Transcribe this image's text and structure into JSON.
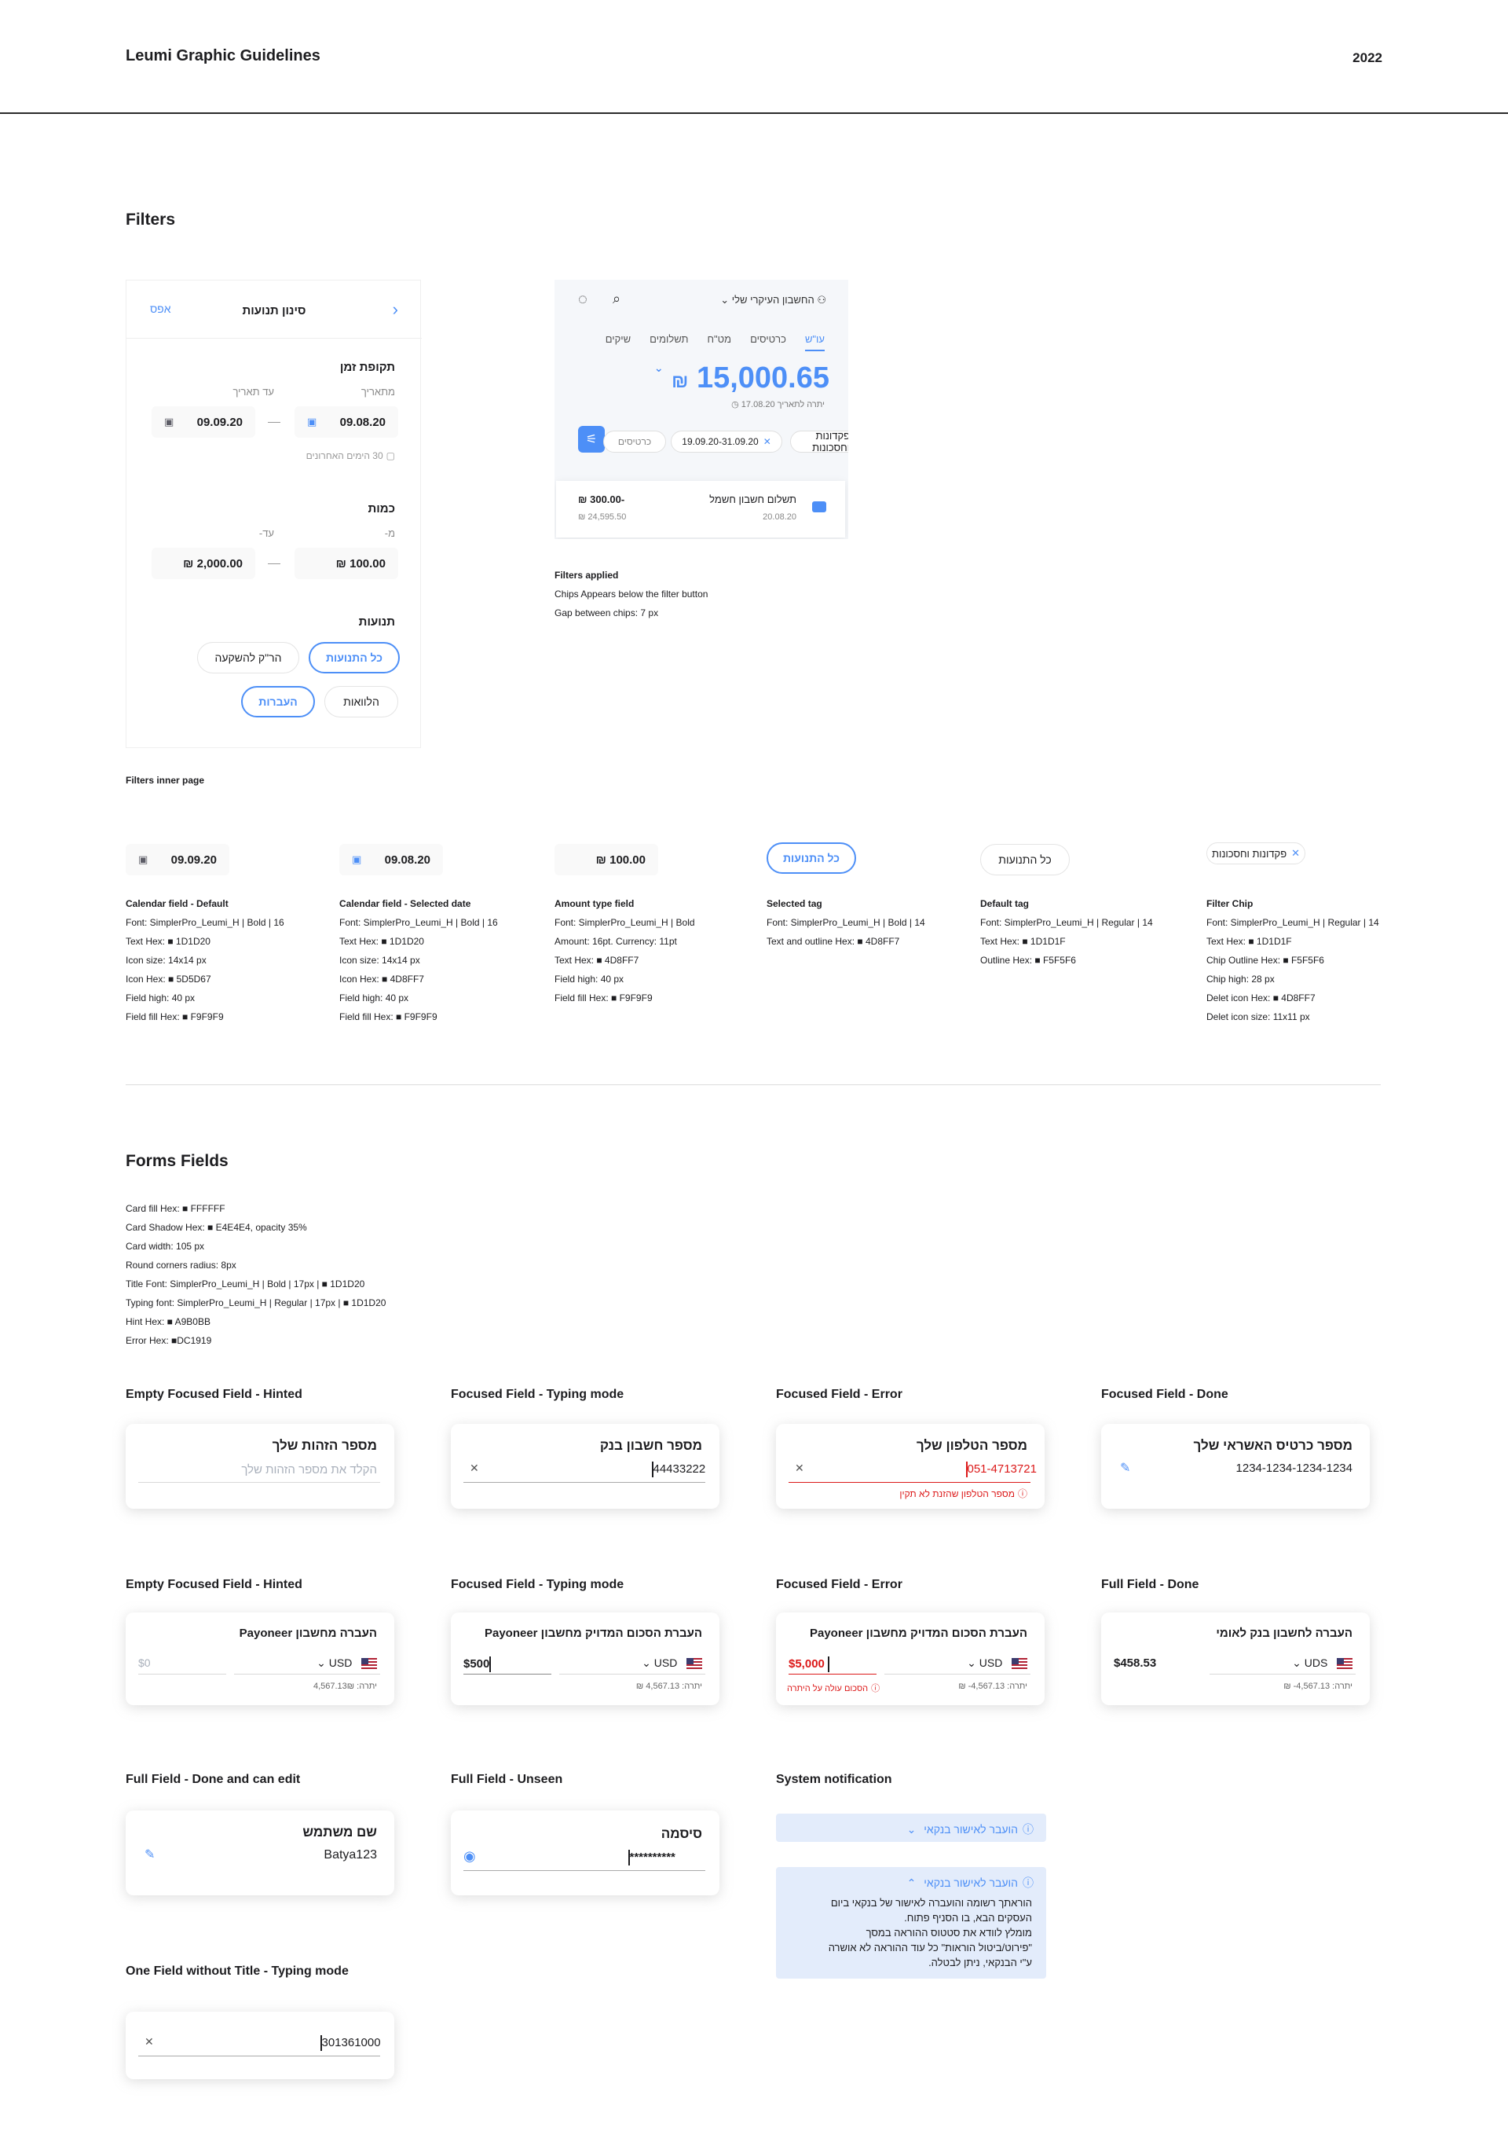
{
  "header": {
    "title": "Leumi Graphic Guidelines",
    "year": "2022"
  },
  "filters": {
    "section_title": "Filters",
    "panel": {
      "reset": "אפס",
      "title": "סינון תנועות",
      "period_heading": "תקופת זמן",
      "from_label": "מתאריך",
      "to_label": "עד תאריך",
      "from_date": "09.08.20",
      "to_date": "09.09.20",
      "last_days": "30 הימים האחרונים",
      "amount_heading": "כמות",
      "amount_from_label": "מ-",
      "amount_to_label": "עד-",
      "amount_from": "100.00 ₪",
      "amount_to": "2,000.00 ₪",
      "tx_heading": "תנועות",
      "tag_all": "כל התנועות",
      "tag_invest": "הר\"ק להשקעה",
      "tag_transfers": "העברות",
      "tag_loans": "הלוואות"
    },
    "caption": "Filters inner page",
    "app": {
      "account": "החשבון העיקרי שלי",
      "tabs": [
        "עו\"ש",
        "כרטיסים",
        "מט\"ח",
        "תשלומים",
        "שיקים"
      ],
      "balance": "15,000.65",
      "currency": "₪",
      "balance_date": "יתרה לתאריך 17.08.20",
      "chips": [
        "פקדונות וחסכונות",
        "19.09.20-31.09.20",
        "כרטיסים"
      ],
      "tx_name": "תשלום חשבון חשמל",
      "tx_date": "20.08.20",
      "tx_amount": "-300.00 ₪",
      "tx_balance": "24,595.50 ₪"
    },
    "applied_notes": [
      "Filters applied",
      "Chips Appears below the filter button",
      "Gap between chips: 7 px"
    ]
  },
  "components": [
    {
      "sample": "09.09.20",
      "title": "Calendar field - Default",
      "lines": [
        "Font: SimplerPro_Leumi_H | Bold | 16",
        "Text Hex: ■ 1D1D20",
        "Icon size: 14x14 px",
        "Icon Hex: ■ 5D5D67",
        "Field high: 40 px",
        "Field fill Hex: ■ F9F9F9"
      ]
    },
    {
      "sample": "09.08.20",
      "title": "Calendar field - Selected date",
      "lines": [
        "Font: SimplerPro_Leumi_H | Bold | 16",
        "Text Hex: ■ 1D1D20",
        "Icon size: 14x14 px",
        "Icon Hex: ■ 4D8FF7",
        "Field high: 40 px",
        "Field fill Hex: ■ F9F9F9"
      ]
    },
    {
      "sample": "100.00 ₪",
      "title": "Amount type field",
      "lines": [
        "Font: SimplerPro_Leumi_H | Bold",
        "Amount: 16pt. Currency: 11pt",
        "Text Hex: ■ 4D8FF7",
        "Field high: 40 px",
        "Field fill Hex: ■ F9F9F9"
      ]
    },
    {
      "sample": "כל התנועות",
      "title": "Selected tag",
      "lines": [
        "Font: SimplerPro_Leumi_H | Bold | 14",
        "Text and outline Hex: ■ 4D8FF7"
      ]
    },
    {
      "sample": "כל התנועות",
      "title": "Default tag",
      "lines": [
        "Font: SimplerPro_Leumi_H | Regular | 14",
        "Text Hex: ■ 1D1D1F",
        "Outline Hex: ■ F5F5F6"
      ]
    },
    {
      "sample": "פקדונות וחסכונות",
      "title": "Filter Chip",
      "lines": [
        "Font: SimplerPro_Leumi_H | Regular | 14",
        "Text Hex: ■ 1D1D1F",
        "Chip Outline Hex: ■ F5F5F6",
        "Chip high: 28 px",
        "Delet icon Hex: ■ 4D8FF7",
        "Delet icon size: 11x11 px"
      ]
    }
  ],
  "forms": {
    "section_title": "Forms Fields",
    "specs": [
      "Card fill Hex: ■ FFFFFF",
      "Card Shadow Hex: ■ E4E4E4, opacity 35%",
      "Card width: 105 px",
      "Round corners radius: 8px",
      "Title Font: SimplerPro_Leumi_H | Bold | 17px | ■ 1D1D20",
      "Typing font: SimplerPro_Leumi_H | Regular | 17px | ■ 1D1D20",
      "Hint Hex: ■ A9B0BB",
      "Error Hex: ■DC1919"
    ],
    "row1": [
      {
        "caption": "Empty Focused Field - Hinted",
        "label": "מספר הזהות שלך",
        "hint": "הקלד את מספר הזהות שלך"
      },
      {
        "caption": "Focused Field - Typing mode",
        "label": "מספר חשבון בנק",
        "value": "44433222"
      },
      {
        "caption": "Focused Field - Error",
        "label": "מספר הטלפון שלך",
        "value": "051-4713721",
        "error": "מספר הטלפון שהזנת לא תקין"
      },
      {
        "caption": "Focused Field - Done",
        "label": "מספר כרטיס האשראי שלך",
        "value": "1234-1234-1234-1234"
      }
    ],
    "row2": [
      {
        "caption": "Empty Focused Field - Hinted",
        "label": "העברה מחשבון Payoneer",
        "value": "$0",
        "currency": "USD",
        "balance": "יתרה: 4,567.13₪"
      },
      {
        "caption": "Focused Field - Typing mode",
        "label": "העברת הסכום המדויק מחשבון Payoneer",
        "value": "$500",
        "currency": "USD",
        "balance": "יתרה: 4,567.13 ₪"
      },
      {
        "caption": "Focused Field - Error",
        "label": "העברת הסכום המדויק מחשבון Payoneer",
        "value": "$5,000",
        "currency": "USD",
        "balance": "יתרה: 4,567.13- ₪",
        "error": "הסכום עולה על היתרה"
      },
      {
        "caption": "Full Field - Done",
        "label": "העברה לחשבון בנק לאומי",
        "value": "$458.53",
        "currency": "UDS",
        "balance": "יתרה: 4,567.13- ₪"
      }
    ],
    "row3": [
      {
        "caption": "Full Field - Done and can edit",
        "label": "שם משתמש",
        "value": "Batya123"
      },
      {
        "caption": "Full Field - Unseen",
        "label": "סיסמה",
        "value": "**********"
      }
    ],
    "notification": {
      "caption": "System notification",
      "collapsed": "הועבר לאישור בנקאי",
      "expanded_title": "הועבר לאישור בנקאי",
      "body": [
        "הוראתך רשומה והועברה לאישור של בנקאי ביום",
        "העסקים הבא, בו הסניף פתוח.",
        "מומלץ לוודא את סטטוס ההוראה במסך",
        "\"פירוט/ביטול הוראות\" כל עוד ההוראה לא אושרה",
        "ע\"י הבנקאי, ניתן לבטלה."
      ]
    },
    "single": {
      "caption": "One Field without Title - Typing mode",
      "value": "301361000"
    }
  }
}
